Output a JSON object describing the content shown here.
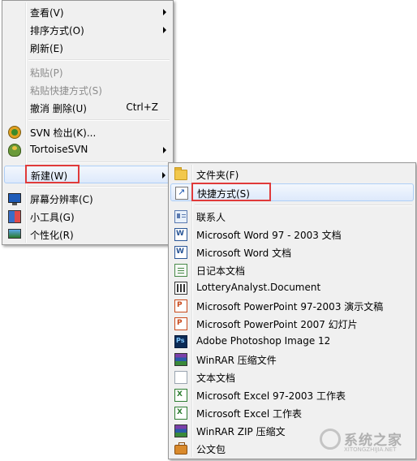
{
  "context_menu": {
    "items": [
      {
        "label": "查看(V)",
        "has_submenu": true
      },
      {
        "label": "排序方式(O)",
        "has_submenu": true
      },
      {
        "label": "刷新(E)"
      },
      {
        "label": "粘贴(P)",
        "disabled": true
      },
      {
        "label": "粘贴快捷方式(S)",
        "disabled": true
      },
      {
        "label": "撤消 删除(U)",
        "shortcut": "Ctrl+Z"
      },
      {
        "label": "SVN 检出(K)...",
        "icon": "svn-checkout-icon"
      },
      {
        "label": "TortoiseSVN",
        "icon": "tortoisesvn-icon",
        "has_submenu": true
      },
      {
        "label": "新建(W)",
        "has_submenu": true,
        "highlighted": true
      },
      {
        "label": "屏幕分辨率(C)",
        "icon": "monitor-icon"
      },
      {
        "label": "小工具(G)",
        "icon": "gadget-icon"
      },
      {
        "label": "个性化(R)",
        "icon": "personalize-icon"
      }
    ]
  },
  "new_submenu": {
    "items": [
      {
        "label": "文件夹(F)",
        "icon": "folder-icon"
      },
      {
        "label": "快捷方式(S)",
        "icon": "shortcut-icon",
        "highlighted": true
      },
      {
        "label": "联系人",
        "icon": "contact-icon"
      },
      {
        "label": "Microsoft Word 97 - 2003 文档",
        "icon": "word-icon"
      },
      {
        "label": "Microsoft Word 文档",
        "icon": "word-icon"
      },
      {
        "label": "日记本文档",
        "icon": "journal-icon"
      },
      {
        "label": "LotteryAnalyst.Document",
        "icon": "lottery-icon"
      },
      {
        "label": "Microsoft PowerPoint 97-2003 演示文稿",
        "icon": "powerpoint-icon"
      },
      {
        "label": "Microsoft PowerPoint 2007 幻灯片",
        "icon": "powerpoint-icon"
      },
      {
        "label": "Adobe Photoshop Image 12",
        "icon": "photoshop-icon"
      },
      {
        "label": "WinRAR 压缩文件",
        "icon": "winrar-icon"
      },
      {
        "label": "文本文档",
        "icon": "text-document-icon"
      },
      {
        "label": "Microsoft Excel 97-2003 工作表",
        "icon": "excel-icon"
      },
      {
        "label": "Microsoft Excel 工作表",
        "icon": "excel-icon"
      },
      {
        "label": "WinRAR ZIP 压缩文",
        "icon": "winrar-zip-icon"
      },
      {
        "label": "公文包",
        "icon": "briefcase-icon"
      }
    ]
  },
  "watermark": {
    "title": "系统之家",
    "subtitle": "XITONGZHIJIA.NET"
  },
  "colors": {
    "menu_bg": "#f0f0f0",
    "highlight_box": "#e03a3a",
    "hover_border": "#aecff7"
  }
}
